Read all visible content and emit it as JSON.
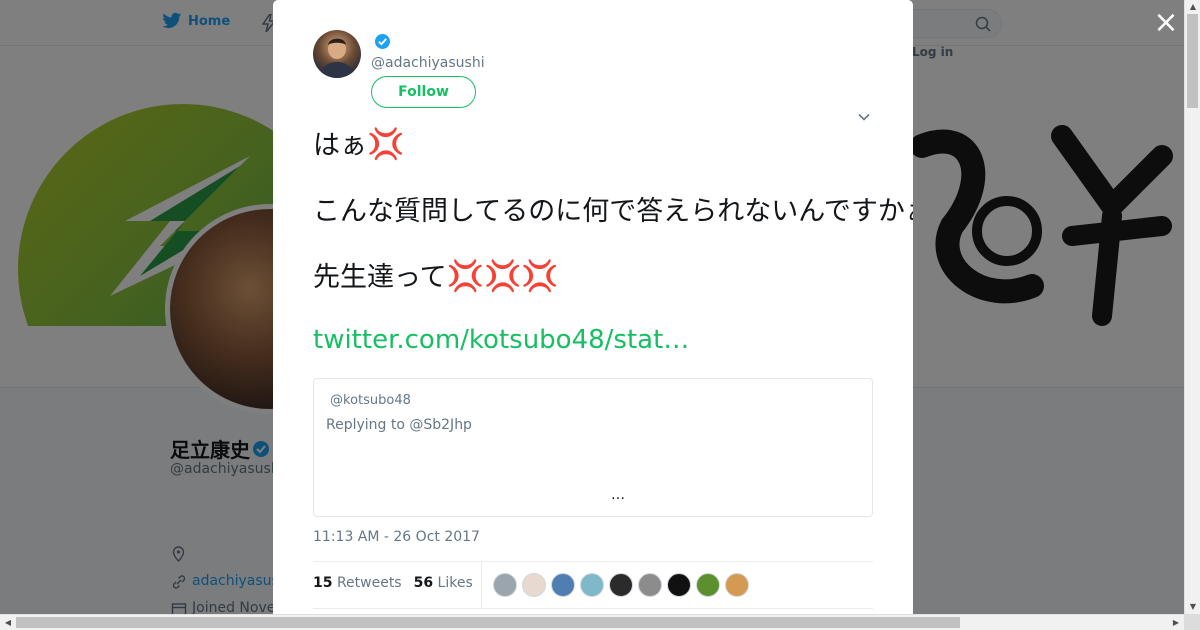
{
  "nav": {
    "home_label": "Home",
    "login_label": "Log in"
  },
  "background_profile": {
    "display_name": "足立康史",
    "handle": "@adachiyasushi",
    "link_text": "adachiyasushi",
    "joined_text": "Joined Nove"
  },
  "tweet": {
    "author_handle": "@adachiyasushi",
    "verified": true,
    "follow_label": "Follow",
    "lines": [
      {
        "text": "はぁ",
        "emoji": "💢"
      },
      {
        "text": "こんな質問してるのに何で答えられないんですかぁ",
        "emoji": "💢💢"
      },
      {
        "text": "先生達って",
        "emoji": "💢💢💢"
      }
    ],
    "link_text": "twitter.com/kotsubo48/stat…",
    "quoted": {
      "handle": "@kotsubo48",
      "reply_text": "Replying to @Sb2Jhp",
      "ellipsis": "…"
    },
    "timestamp": "11:13 AM - 26 Oct 2017",
    "retweets_count": "15",
    "retweets_label": "Retweets",
    "likes_count": "56",
    "likes_label": "Likes"
  },
  "liker_colors": [
    "#9aa5ad",
    "#e8d9d0",
    "#4f7fb0",
    "#7fb8c9",
    "#2b2b2b",
    "#8c8c8c",
    "#111111",
    "#5c8f2e",
    "#d49a52"
  ],
  "colors": {
    "accent_green": "#17bf63",
    "twitter_blue": "#1da1f2",
    "text_primary": "#14171a",
    "text_secondary": "#657786",
    "anger_red": "#d0223b"
  },
  "close_label": "×"
}
